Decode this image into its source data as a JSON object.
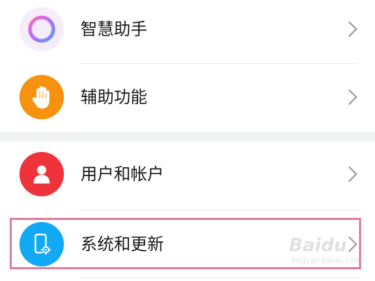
{
  "settings": {
    "groups": [
      {
        "items": [
          {
            "label": "智慧助手",
            "icon": "assistant-ring-icon",
            "icon_bg": "#f5eefa"
          },
          {
            "label": "辅助功能",
            "icon": "hand-icon",
            "icon_bg": "#f7920f"
          }
        ]
      },
      {
        "items": [
          {
            "label": "用户和帐户",
            "icon": "user-icon",
            "icon_bg": "#f0333a"
          },
          {
            "label": "系统和更新",
            "icon": "phone-gear-icon",
            "icon_bg": "#12a9f4",
            "highlighted": true
          }
        ]
      }
    ]
  },
  "colors": {
    "highlight_border": "#e47b9d",
    "group_gap": "#f1f3f5",
    "chevron": "#9a9a9a"
  },
  "watermark": {
    "text": "Baidu",
    "sub": "jingyan.baidu.com"
  }
}
